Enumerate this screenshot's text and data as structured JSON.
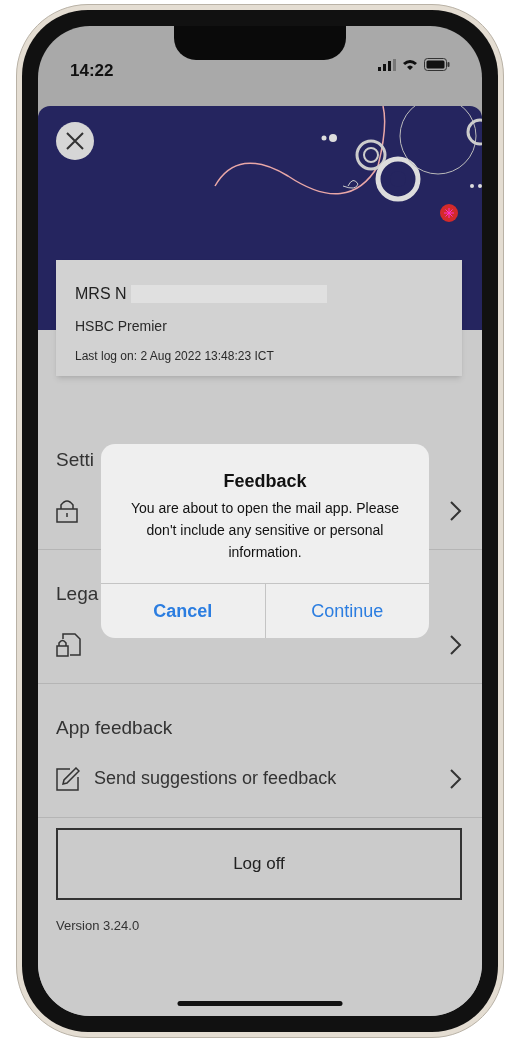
{
  "status_bar": {
    "time": "14:22"
  },
  "profile": {
    "name": "MRS N",
    "plan": "HSBC Premier",
    "last_logon": "Last log on: 2 Aug 2022 13:48:23 ICT"
  },
  "sections": [
    {
      "title": "Setti",
      "rows": [
        {
          "kind": "lock"
        }
      ]
    },
    {
      "title": "Lega",
      "rows": [
        {
          "kind": "document-lock"
        }
      ]
    },
    {
      "title": "App feedback",
      "rows": [
        {
          "kind": "edit",
          "label": "Send suggestions or feedback"
        }
      ]
    }
  ],
  "logoff_button": "Log off",
  "version": "Version 3.24.0",
  "dialog": {
    "title": "Feedback",
    "message": "You are about to open the mail app. Please don't include any sensitive or personal information.",
    "buttons": [
      {
        "label": "Cancel",
        "bold": true
      },
      {
        "label": "Continue",
        "bold": false
      }
    ]
  }
}
